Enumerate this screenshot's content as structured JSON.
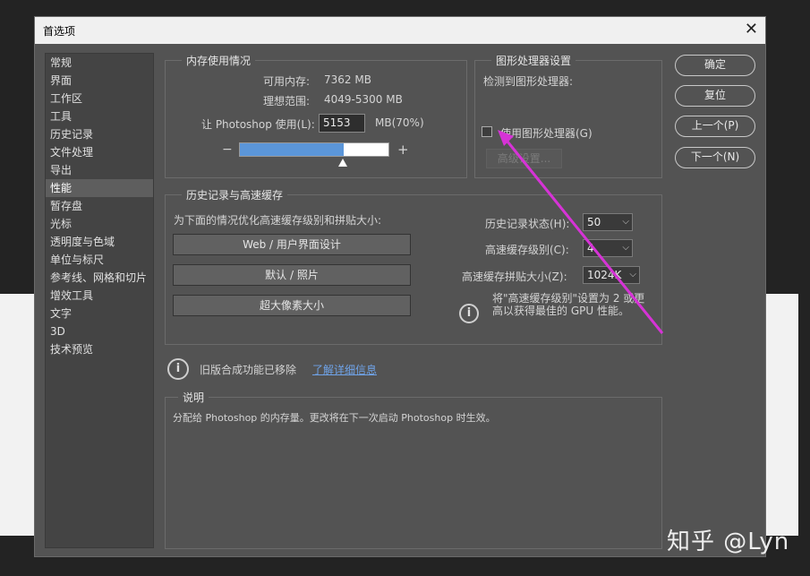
{
  "window": {
    "title": "首选项",
    "close_glyph": "✕"
  },
  "sidebar": {
    "items": [
      {
        "label": "常规"
      },
      {
        "label": "界面"
      },
      {
        "label": "工作区"
      },
      {
        "label": "工具"
      },
      {
        "label": "历史记录"
      },
      {
        "label": "文件处理"
      },
      {
        "label": "导出"
      },
      {
        "label": "性能",
        "selected": true
      },
      {
        "label": "暂存盘"
      },
      {
        "label": "光标"
      },
      {
        "label": "透明度与色域"
      },
      {
        "label": "单位与标尺"
      },
      {
        "label": "参考线、网格和切片"
      },
      {
        "label": "增效工具"
      },
      {
        "label": "文字"
      },
      {
        "label": "3D"
      },
      {
        "label": "技术预览"
      }
    ]
  },
  "memory": {
    "legend": "内存使用情况",
    "available_label": "可用内存:",
    "available_value": "7362 MB",
    "ideal_label": "理想范围:",
    "ideal_value": "4049-5300 MB",
    "let_label": "让 Photoshop 使用(L):",
    "let_value": "5153",
    "unit_pct": "MB(70%)",
    "fill_fraction": 0.7,
    "minus": "−",
    "plus": "+"
  },
  "gpu": {
    "legend": "图形处理器设置",
    "detected_label": "检测到图形处理器:",
    "use_gpu_label": "使用图形处理器(G)",
    "use_gpu_checked": false,
    "advanced_label": "高级设置..."
  },
  "history_cache": {
    "legend": "历史记录与高速缓存",
    "optimize_label": "为下面的情况优化高速缓存级别和拼贴大小:",
    "buttons": [
      "Web / 用户界面设计",
      "默认 / 照片",
      "超大像素大小"
    ],
    "history_states_label": "历史记录状态(H):",
    "history_states_value": "50",
    "cache_levels_label": "高速缓存级别(C):",
    "cache_levels_value": "4",
    "tile_size_label": "高速缓存拼贴大小(Z):",
    "tile_size_value": "1024K",
    "tip_line1": "将\"高速缓存级别\"设置为 2 或更",
    "tip_line2": "高以获得最佳的 GPU 性能。"
  },
  "legacy": {
    "message": "旧版合成功能已移除",
    "link": "了解详细信息"
  },
  "description": {
    "legend": "说明",
    "text": "分配给 Photoshop 的内存量。更改将在下一次启动 Photoshop 时生效。"
  },
  "actions": {
    "ok": "确定",
    "reset": "复位",
    "prev": "上一个(P)",
    "next": "下一个(N)"
  },
  "watermark": "知乎 @Lyn",
  "colors": {
    "dialog_bg": "#535353",
    "slider_fill": "#5b96d9",
    "annotation_arrow": "#d633d6",
    "link": "#6fa3e8"
  }
}
